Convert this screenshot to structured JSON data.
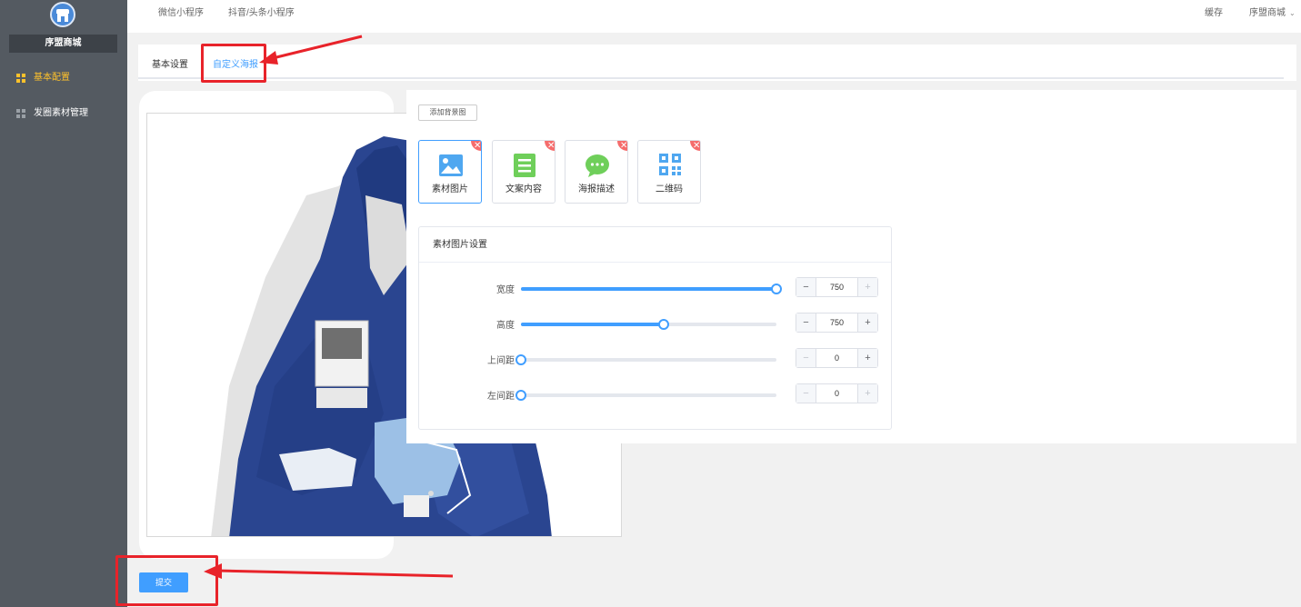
{
  "sidebar": {
    "brand": "序盟商城",
    "items": [
      {
        "label": "基本配置",
        "active": true
      },
      {
        "label": "发圈素材管理",
        "active": false
      }
    ]
  },
  "topbar": {
    "tabs": [
      "微信小程序",
      "抖音/头条小程序"
    ],
    "cache": "缓存",
    "user": "序盟商城"
  },
  "page_tabs": [
    "基本设置",
    "自定义海报"
  ],
  "editor": {
    "add_bg_label": "添加背景图",
    "tools": [
      {
        "label": "素材图片",
        "icon": "image-icon"
      },
      {
        "label": "文案内容",
        "icon": "document-icon"
      },
      {
        "label": "海报描述",
        "icon": "chat-bubble-icon"
      },
      {
        "label": "二维码",
        "icon": "qrcode-icon"
      }
    ],
    "settings_title": "素材图片设置",
    "rows": [
      {
        "label": "宽度",
        "value": "750",
        "level": 1.0
      },
      {
        "label": "高度",
        "value": "750",
        "level": 0.56
      },
      {
        "label": "上间距",
        "value": "0",
        "level": 0.0
      },
      {
        "label": "左间距",
        "value": "0",
        "level": 0.0
      }
    ]
  },
  "submit_label": "提交",
  "colors": {
    "accent": "#409eff",
    "sidebar": "#545a61",
    "active_nav": "#ffc22b",
    "annotation": "#e8232a"
  }
}
